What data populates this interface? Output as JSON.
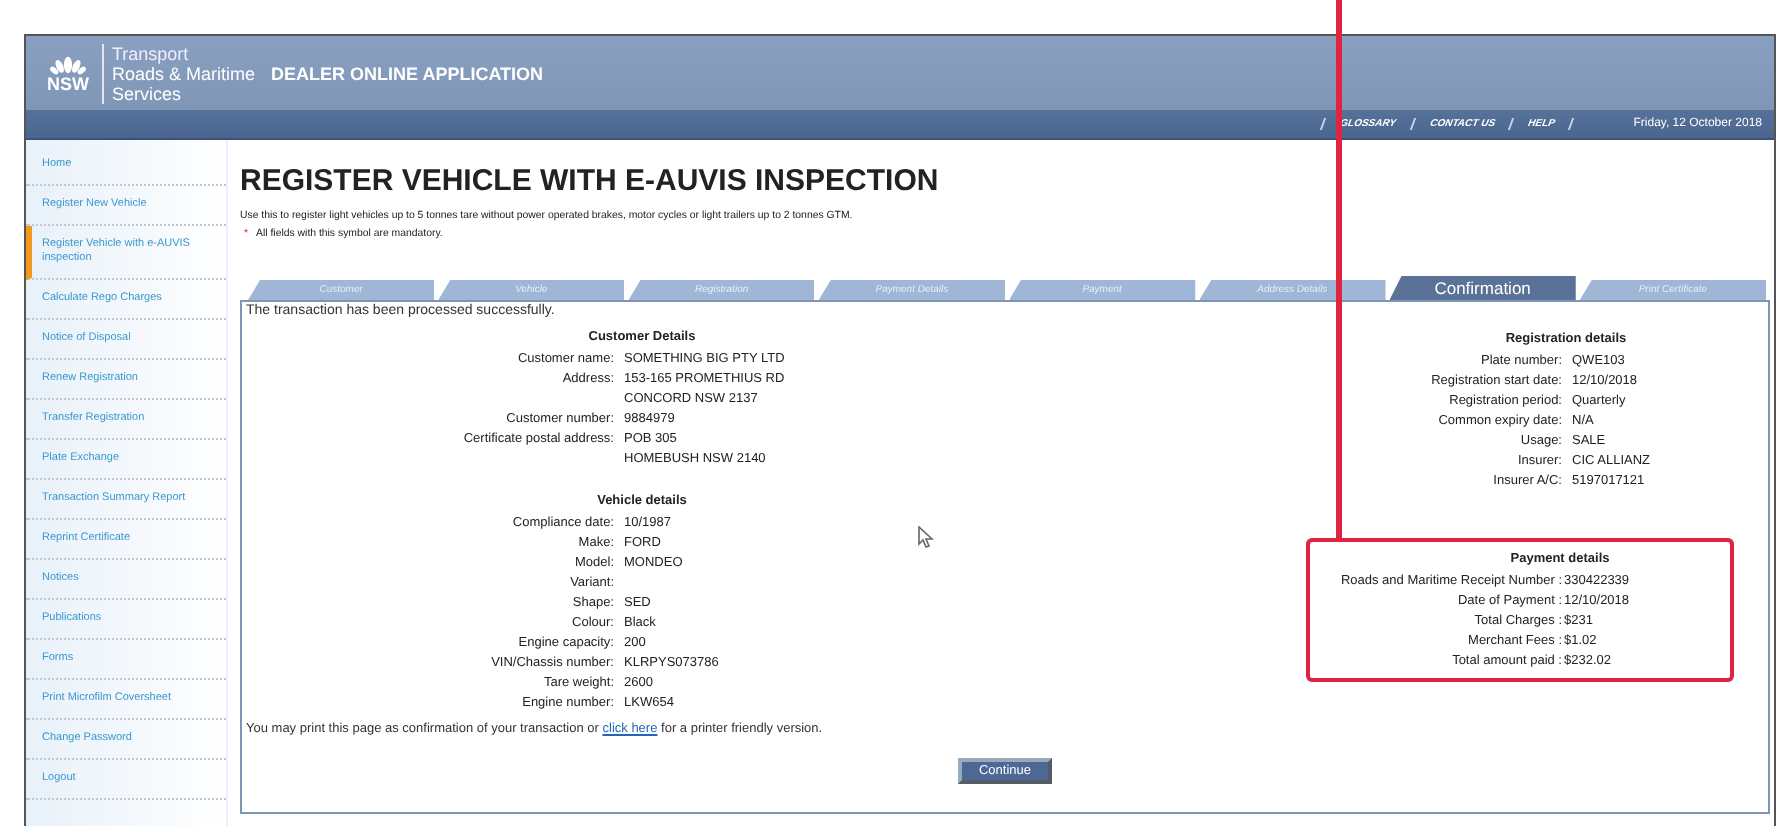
{
  "header": {
    "brand": "NSW",
    "brand_lines": [
      "Transport",
      "Roads & Maritime",
      "Services"
    ],
    "app_title": "DEALER ONLINE APPLICATION"
  },
  "top_links": [
    "GLOSSARY",
    "CONTACT US",
    "HELP"
  ],
  "date": "Friday, 12 October 2018",
  "sidebar": {
    "items": [
      {
        "label": "Home",
        "selected": false
      },
      {
        "label": "Register New Vehicle",
        "selected": false
      },
      {
        "label": "Register Vehicle with e-AUVIS inspection",
        "selected": true
      },
      {
        "label": "Calculate Rego Charges",
        "selected": false
      },
      {
        "label": "Notice of Disposal",
        "selected": false
      },
      {
        "label": "Renew Registration",
        "selected": false
      },
      {
        "label": "Transfer Registration",
        "selected": false
      },
      {
        "label": "Plate Exchange",
        "selected": false
      },
      {
        "label": "Transaction Summary Report",
        "selected": false
      },
      {
        "label": "Reprint Certificate",
        "selected": false
      },
      {
        "label": "Notices",
        "selected": false
      },
      {
        "label": "Publications",
        "selected": false
      },
      {
        "label": "Forms",
        "selected": false
      },
      {
        "label": "Print Microfilm Coversheet",
        "selected": false
      },
      {
        "label": "Change Password",
        "selected": false
      },
      {
        "label": "Logout",
        "selected": false
      }
    ]
  },
  "page_title": "REGISTER VEHICLE WITH E-AUVIS INSPECTION",
  "intro": "Use this to register light vehicles up to 5 tonnes tare without power operated brakes, motor cycles or light trailers up to 2 tonnes GTM.",
  "mandatory_note": {
    "mark": "*",
    "text": "All fields with this symbol are mandatory."
  },
  "tabs": [
    {
      "label": "Customer",
      "selected": false
    },
    {
      "label": "Vehicle",
      "selected": false
    },
    {
      "label": "Registration",
      "selected": false
    },
    {
      "label": "Payment Details",
      "selected": false
    },
    {
      "label": "Payment",
      "selected": false
    },
    {
      "label": "Address Details",
      "selected": false
    },
    {
      "label": "Confirmation",
      "selected": true
    },
    {
      "label": "Print Certificate",
      "selected": false
    }
  ],
  "success_message": "The transaction has been processed successfully.",
  "left_sections": [
    {
      "title": "Customer Details",
      "highlighted": false,
      "rows": [
        {
          "label": "Customer name:",
          "value": [
            "SOMETHING BIG PTY LTD"
          ]
        },
        {
          "label": "Address:",
          "value": [
            "153-165 PROMETHIUS RD",
            "CONCORD NSW 2137"
          ]
        },
        {
          "label": "Customer number:",
          "value": [
            "9884979"
          ]
        },
        {
          "label": "Certificate postal address:",
          "value": [
            "POB 305",
            "HOMEBUSH NSW 2140"
          ]
        }
      ]
    },
    {
      "title": "Vehicle details",
      "highlighted": false,
      "rows": [
        {
          "label": "Compliance date:",
          "value": [
            "10/1987"
          ]
        },
        {
          "label": "Make:",
          "value": [
            "FORD"
          ]
        },
        {
          "label": "Model:",
          "value": [
            "MONDEO"
          ]
        },
        {
          "label": "Variant:",
          "value": []
        },
        {
          "label": "Shape:",
          "value": [
            "SED"
          ]
        },
        {
          "label": "Colour:",
          "value": [
            "Black"
          ]
        },
        {
          "label": "Engine capacity:",
          "value": [
            "200"
          ]
        },
        {
          "label": "VIN/Chassis number:",
          "value": [
            "KLRPYS073786"
          ]
        },
        {
          "label": "Tare weight:",
          "value": [
            "2600"
          ]
        },
        {
          "label": "Engine number:",
          "value": [
            "LKW654"
          ]
        }
      ]
    }
  ],
  "right_sections": [
    {
      "title": "Registration details",
      "highlighted": false,
      "rows": [
        {
          "label": "Plate number:",
          "value": [
            "QWE103"
          ]
        },
        {
          "label": "Registration start date:",
          "value": [
            "12/10/2018"
          ]
        },
        {
          "label": "Registration period:",
          "value": [
            "Quarterly"
          ]
        },
        {
          "label": "Common expiry date:",
          "value": [
            "N/A"
          ]
        },
        {
          "label": "Usage:",
          "value": [
            "SALE"
          ]
        },
        {
          "label": "Insurer:",
          "value": [
            "CIC ALLIANZ"
          ]
        },
        {
          "label": "Insurer A/C:",
          "value": [
            "5197017121"
          ]
        }
      ]
    },
    {
      "title": "Payment details",
      "highlighted": true,
      "rows": [
        {
          "label": "Roads and Maritime Receipt Number :",
          "value": [
            "330422339"
          ]
        },
        {
          "label": "Date of Payment :",
          "value": [
            "12/10/2018"
          ]
        },
        {
          "label": "Total Charges :",
          "value": [
            "$231"
          ]
        },
        {
          "label": "Merchant Fees :",
          "value": [
            "$1.02"
          ]
        },
        {
          "label": "Total amount paid :",
          "value": [
            "$232.02"
          ]
        }
      ]
    }
  ],
  "print_note": {
    "before": "You may print this page as confirmation of your transaction or",
    "link": "click here",
    "after": "for a printer friendly version."
  },
  "continue_button": "Continue"
}
